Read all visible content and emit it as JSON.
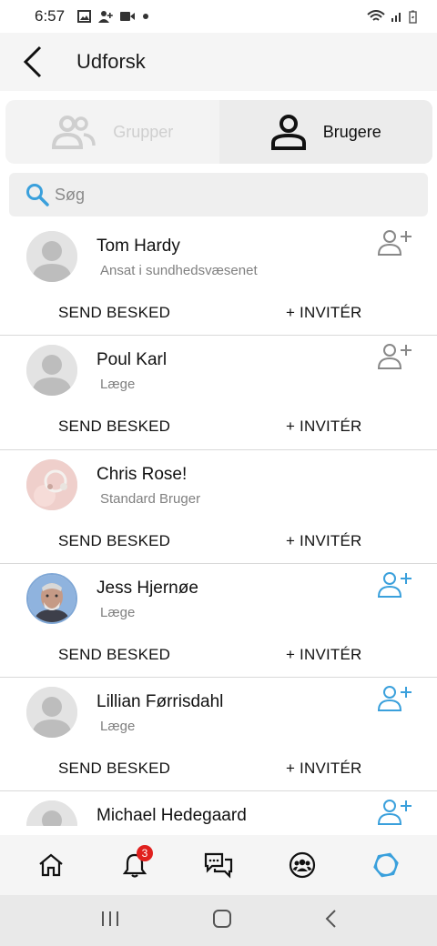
{
  "status_bar": {
    "time": "6:57"
  },
  "header": {
    "title": "Udforsk"
  },
  "segments": [
    {
      "label": "Grupper",
      "active": false
    },
    {
      "label": "Brugere",
      "active": true
    }
  ],
  "search": {
    "placeholder": "Søg"
  },
  "users": [
    {
      "name": "Tom Hardy",
      "role": "Ansat i sundhedsvæsenet",
      "avatar": "default",
      "add_color": "#888888",
      "send_label": "SEND BESKED",
      "invite_label": "+ INVITÉR"
    },
    {
      "name": "Poul Karl",
      "role": "Læge",
      "avatar": "default",
      "add_color": "#888888",
      "send_label": "SEND BESKED",
      "invite_label": "+ INVITÉR"
    },
    {
      "name": "Chris Rose!",
      "role": "Standard Bruger",
      "avatar": "photo-ring",
      "add_color": null,
      "send_label": "SEND BESKED",
      "invite_label": "+ INVITÉR"
    },
    {
      "name": "Jess Hjernøe",
      "role": "Læge",
      "avatar": "photo-man",
      "add_color": "#3aa0dc",
      "send_label": "SEND BESKED",
      "invite_label": "+ INVITÉR"
    },
    {
      "name": "Lillian Førrisdahl",
      "role": "Læge",
      "avatar": "default",
      "add_color": "#3aa0dc",
      "send_label": "SEND BESKED",
      "invite_label": "+ INVITÉR"
    },
    {
      "name": "Michael Hedegaard",
      "role": "",
      "avatar": "default",
      "add_color": "#3aa0dc",
      "send_label": "",
      "invite_label": ""
    }
  ],
  "bottom_nav": {
    "items": [
      "home-icon",
      "bell-icon",
      "chat-icon",
      "groups-icon",
      "profile-icon"
    ],
    "notification_count": "3",
    "active_color": "#3aa0dc"
  },
  "colors": {
    "accent": "#3aa0dc",
    "badge": "#e0201e"
  }
}
